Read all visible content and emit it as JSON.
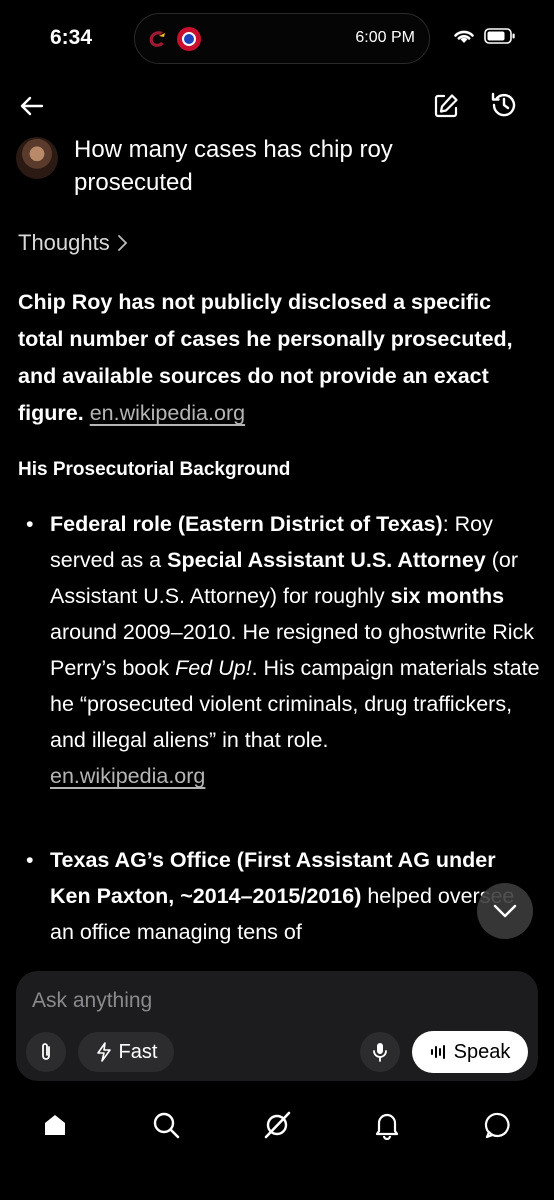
{
  "status_bar": {
    "time": "6:34",
    "island_time": "6:00 PM"
  },
  "header": {
    "question": "How many cases has chip roy prosecuted"
  },
  "thoughts": {
    "label": "Thoughts"
  },
  "answer": {
    "intro": "Chip Roy has not publicly disclosed a specific total number of cases he personally prosecuted, and available sources do not provide an exact figure.",
    "source": "en.wikipedia.org"
  },
  "section": {
    "heading": "His Prosecutorial Background"
  },
  "bullets": [
    {
      "title": "Federal role (Eastern District of Texas)",
      "t1": "Roy served as a ",
      "b1": "Special Assistant U.S. Attorney",
      "t2": " (or Assistant U.S. Attorney) for roughly ",
      "b2": "six months",
      "t3": " around 2009–2010. He resigned to ghostwrite Rick Perry’s book ",
      "i1": "Fed Up!",
      "t4": ". His campaign materials state he “prosecuted violent criminals, drug traffickers, and illegal aliens” in that role.",
      "source": "en.wikipedia.org"
    },
    {
      "title": "Texas AG’s Office (First Assistant AG under Ken Paxton, ~2014–2015/2016)",
      "text": "helped oversee an office managing tens of"
    }
  ],
  "composer": {
    "placeholder": "Ask anything",
    "fast_label": "Fast",
    "speak_label": "Speak"
  },
  "tabbar": {
    "items": [
      "home-icon",
      "search-icon",
      "grok-icon",
      "bell-icon",
      "chat-icon"
    ]
  }
}
